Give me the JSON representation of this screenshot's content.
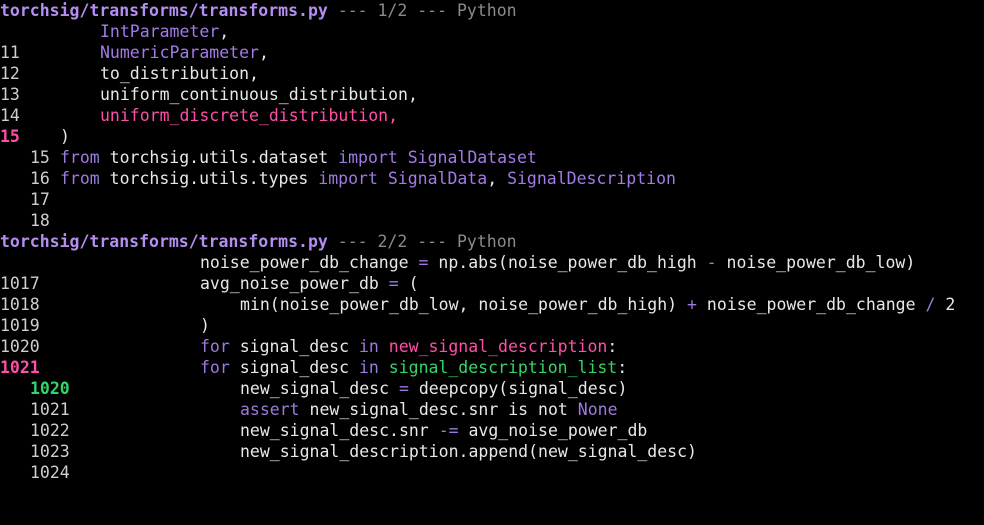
{
  "hunks": [
    {
      "header": {
        "filename": "torchsig/transforms/transforms.py",
        "separator": " --- 1/2 --- ",
        "language": "Python"
      },
      "lines": [
        {
          "num": "11",
          "text": "IntParameter",
          "suffix": ","
        },
        {
          "num": "12",
          "text": "NumericParameter",
          "suffix": ","
        },
        {
          "num": "13",
          "text": "to_distribution,"
        },
        {
          "num": "14",
          "text": "uniform_continuous_distribution,"
        },
        {
          "num": "15",
          "text": "uniform_discrete_distribution,"
        },
        {
          "num": "15",
          "text": ")"
        },
        {
          "num": "16",
          "kw1": "from",
          "mod": " torchsig.utils.dataset ",
          "kw2": "import",
          "name1": " SignalDataset"
        },
        {
          "num": "17",
          "kw1": "from",
          "mod": " torchsig.utils.types ",
          "kw2": "import",
          "name1": " SignalData",
          "comma": ", ",
          "name2": "SignalDescription"
        },
        {
          "num": "18",
          "text": ""
        }
      ]
    },
    {
      "header": {
        "filename": "torchsig/transforms/transforms.py",
        "separator": " --- 2/2 --- ",
        "language": "Python"
      },
      "lines": [
        {
          "num": "1017",
          "a": "noise_power_db_change ",
          "op1": "=",
          "b": " np.abs(noise_power_db_high ",
          "op2": "-",
          "c": " noise_power_db_low)"
        },
        {
          "num": "1018",
          "a": "avg_noise_power_db ",
          "op1": "=",
          "b": " ("
        },
        {
          "num": "1019",
          "a": "min(noise_power_db_low, noise_power_db_high) ",
          "op1": "+",
          "b": " noise_power_db_change ",
          "op2": "/",
          "c": " 2"
        },
        {
          "num": "1020",
          "a": ")"
        },
        {
          "num": "1021",
          "kw1": "for",
          "a": " signal_desc ",
          "kw2": "in",
          "b": " new_signal_description",
          "c": ":"
        },
        {
          "num": "1020",
          "kw1": "for",
          "a": " signal_desc ",
          "kw2": "in",
          "b": " signal_description_list",
          "c": ":"
        },
        {
          "num": "1021",
          "a": "new_signal_desc ",
          "op1": "=",
          "b": " deepcopy(signal_desc)"
        },
        {
          "num": "1022",
          "kw1": "assert",
          "a": " new_signal_desc.snr is not ",
          "kw2": "None"
        },
        {
          "num": "1023",
          "a": "new_signal_desc.snr ",
          "op1": "-=",
          "b": " avg_noise_power_db"
        },
        {
          "num": "1024",
          "a": "new_signal_description.append(new_signal_desc)"
        }
      ]
    }
  ]
}
